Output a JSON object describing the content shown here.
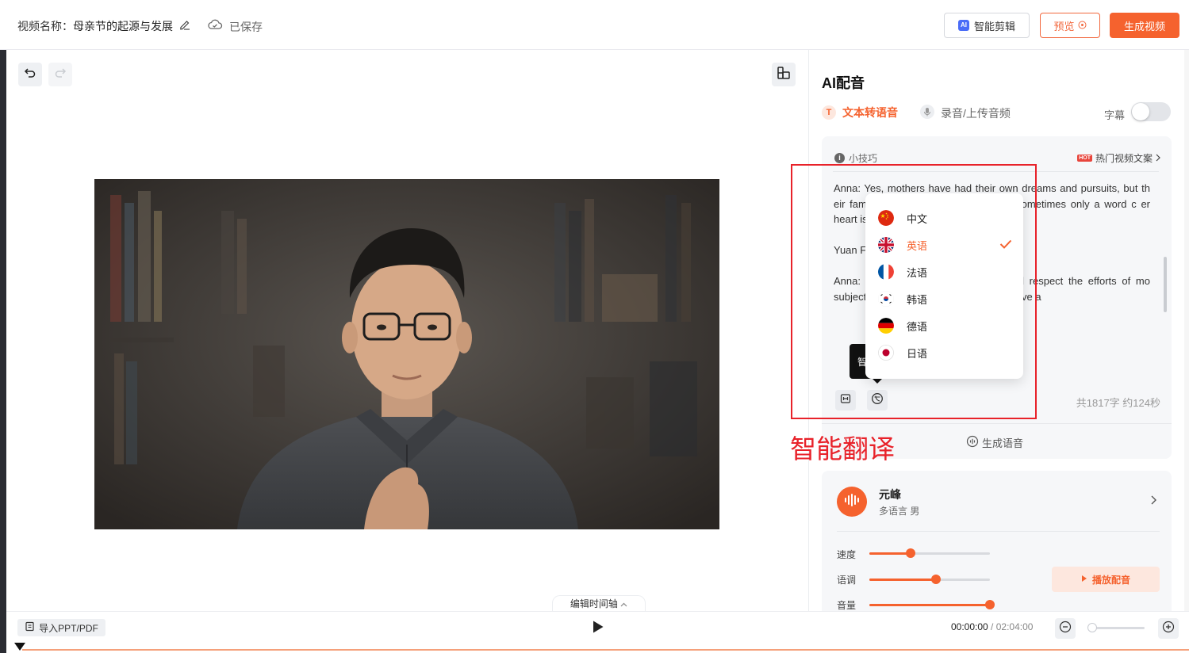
{
  "header": {
    "video_name_label": "视频名称：",
    "video_title": "母亲节的起源与发展",
    "saved_status": "已保存",
    "ai_edit_badge": "AI",
    "ai_edit_button": "智能剪辑",
    "preview_button": "预览",
    "generate_button": "生成视频"
  },
  "canvas": {
    "timeline_toggle": "编辑时间轴"
  },
  "bottom": {
    "import_button": "导入PPT/PDF",
    "current_time": "00:00:00",
    "separator": " / ",
    "total_time": "02:04:00"
  },
  "panel": {
    "title": "AI配音",
    "tab_tts_badge": "T",
    "tab_tts": "文本转语音",
    "tab_record": "录音/上传音频",
    "subtitle_label": "字幕",
    "subtitle_enabled": false,
    "tips_label": "小技巧",
    "hot_badge": "HOT",
    "hot_label": "热门视频文案",
    "paragraphs": [
      "Anna: Yes, mothers have had their own dreams and pursuits, but th            eir families and children. Mothe             l that sometimes only a word c            er heart is very big, big enoug",
      "Yuan F              se flless. What do you think i              y?",
      "Anna:              y to express gratitude, but als              d respect the efforts of mo             subject of letting go, but           efore, please leave a"
    ],
    "count_text": "共1817字 约124秒",
    "generate_voice": "生成语音",
    "voice": {
      "name": "元峰",
      "meta": "多语言  男",
      "speed_label": "速度",
      "pitch_label": "语调",
      "volume_label": "音量",
      "speed_value": 0.34,
      "pitch_value": 0.55,
      "volume_value": 1.0,
      "play_button": "播放配音"
    }
  },
  "tooltip": {
    "text": "智"
  },
  "language_dropdown": {
    "items": [
      {
        "label": "中文",
        "flag": "cn-flag-icon",
        "selected": false
      },
      {
        "label": "英语",
        "flag": "uk-flag-icon",
        "selected": true
      },
      {
        "label": "法语",
        "flag": "fr-flag-icon",
        "selected": false
      },
      {
        "label": "韩语",
        "flag": "kr-flag-icon",
        "selected": false
      },
      {
        "label": "德语",
        "flag": "de-flag-icon",
        "selected": false
      },
      {
        "label": "日语",
        "flag": "jp-flag-icon",
        "selected": false
      }
    ]
  },
  "annotation": {
    "text": "智能翻译",
    "color": "#e8222a"
  },
  "colors": {
    "accent": "#f5622e",
    "annotation_red": "#e8222a"
  }
}
